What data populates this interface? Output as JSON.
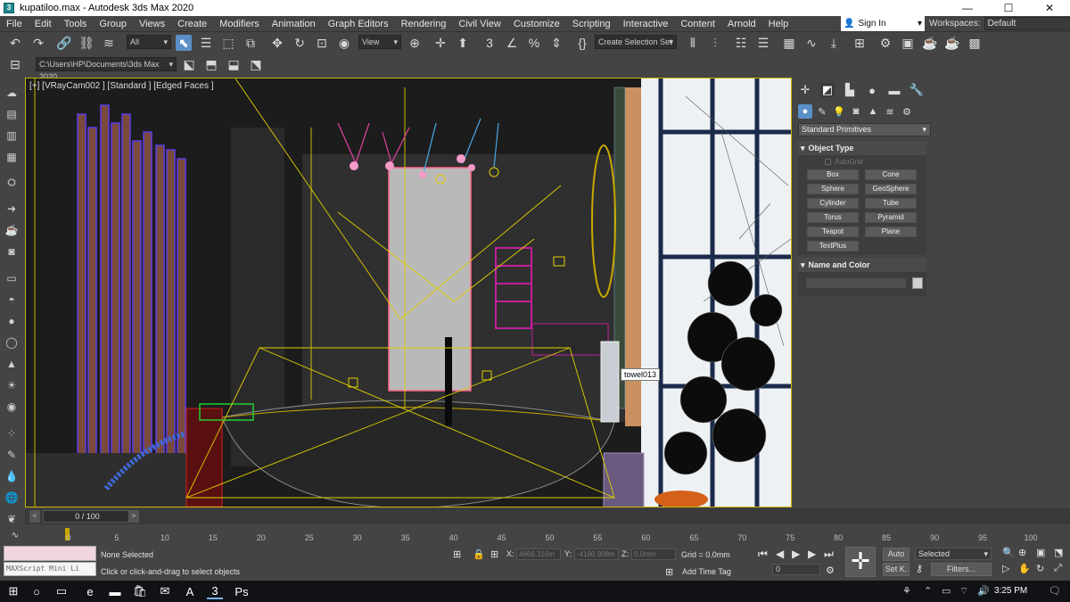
{
  "window": {
    "title": "kupatiloo.max - Autodesk 3ds Max 2020",
    "app_icon": "3ds-max-icon",
    "controls": [
      "minimize",
      "maximize",
      "close"
    ]
  },
  "menu": {
    "items": [
      "File",
      "Edit",
      "Tools",
      "Group",
      "Views",
      "Create",
      "Modifiers",
      "Animation",
      "Graph Editors",
      "Rendering",
      "Civil View",
      "Customize",
      "Scripting",
      "Interactive",
      "Content",
      "Arnold",
      "Help"
    ],
    "sign_in": "Sign In",
    "workspaces_label": "Workspaces:",
    "workspaces_value": "Default"
  },
  "toolbar": {
    "selection_filter": "All",
    "reference_coord": "View",
    "named_selection": "Create Selection Set",
    "project_path": "C:\\Users\\HP\\Documents\\3ds Max 2020"
  },
  "viewport": {
    "label": "[+] [VRayCam002 ] [Standard ] [Edged Faces ]",
    "tooltip": "towel013"
  },
  "command_panel": {
    "category": "Standard Primitives",
    "object_type_title": "Object Type",
    "autogrid": "AutoGrid",
    "primitives": [
      "Box",
      "Cone",
      "Sphere",
      "GeoSphere",
      "Cylinder",
      "Tube",
      "Torus",
      "Pyramid",
      "Teapot",
      "Plane",
      "TextPlus"
    ],
    "name_color_title": "Name and Color",
    "color": "#d0d0d0"
  },
  "timeline": {
    "frame_display": "0 / 100",
    "ticks": [
      "0",
      "5",
      "10",
      "15",
      "20",
      "25",
      "30",
      "35",
      "40",
      "45",
      "50",
      "55",
      "60",
      "65",
      "70",
      "75",
      "80",
      "85",
      "90",
      "95",
      "100"
    ]
  },
  "status": {
    "maxscript": "MAXScript Mini Li",
    "selection": "None Selected",
    "prompt": "Click or click-and-drag to select objects",
    "x_label": "X:",
    "x_value": "4666.316m",
    "y_label": "Y:",
    "y_value": "-4180.908m",
    "z_label": "Z:",
    "z_value": "0.0mm",
    "grid": "Grid = 0.0mm",
    "add_time_tag": "Add Time Tag",
    "auto_key": "Auto",
    "set_key": "Set K.",
    "key_filter_dd": "Selected",
    "filters": "Filters...",
    "current_frame": "0"
  },
  "taskbar": {
    "time": "3:25 PM"
  }
}
